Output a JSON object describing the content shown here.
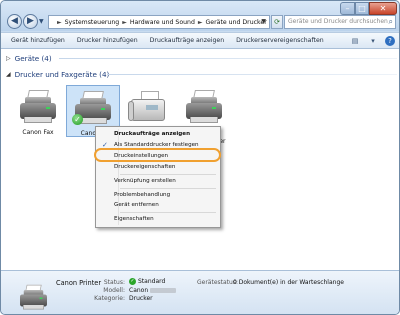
{
  "window": {
    "controls": {
      "minimize": "–",
      "maximize": "□",
      "close": "✕"
    }
  },
  "addressbar": {
    "crumbs": [
      "Systemsteuerung",
      "Hardware und Sound",
      "Geräte und Drucker"
    ]
  },
  "search": {
    "placeholder": "Geräte und Drucker durchsuchen"
  },
  "toolbar": {
    "buttons": [
      "Gerät hinzufügen",
      "Drucker hinzufügen",
      "Druckaufträge anzeigen",
      "Druckerservereigenschaften"
    ]
  },
  "groups": [
    {
      "label": "Geräte (4)",
      "expanded": false
    },
    {
      "label": "Drucker und Faxgeräte (4)",
      "expanded": true
    }
  ],
  "devices": [
    {
      "label": "Canon Fax",
      "type": "printer"
    },
    {
      "label": "Canon P",
      "type": "printer",
      "selected": true,
      "default": true
    },
    {
      "label": "",
      "type": "fax"
    },
    {
      "label": "",
      "type": "printer"
    }
  ],
  "device_partial_label": "ter",
  "context_menu": {
    "items": [
      {
        "label": "Druckaufträge anzeigen",
        "bold": true
      },
      {
        "label": "Als Standarddrucker festlegen",
        "checked": true
      },
      {
        "label": "Druckeinstellungen",
        "highlighted": true
      },
      {
        "label": "Druckereigenschaften"
      },
      {
        "label": "Verknüpfung erstellen"
      },
      {
        "label": "Problembehandlung"
      },
      {
        "label": "Gerät entfernen"
      },
      {
        "label": "Eigenschaften"
      }
    ],
    "highlight_color": "#f0a030"
  },
  "details": {
    "name": "Canon Printer",
    "status_label": "Status:",
    "status_value": "Standard",
    "model_label": "Modell:",
    "model_value": "Canon",
    "category_label": "Kategorie:",
    "category_value": "Drucker",
    "device_status_label": "Gerätestatus:",
    "device_status_value": "0 Dokument(e) in der Warteschlange"
  },
  "colors": {
    "group_header": "#1e3d7a",
    "selection": "#cde3f8",
    "window_frame": "#c9dcf0"
  }
}
